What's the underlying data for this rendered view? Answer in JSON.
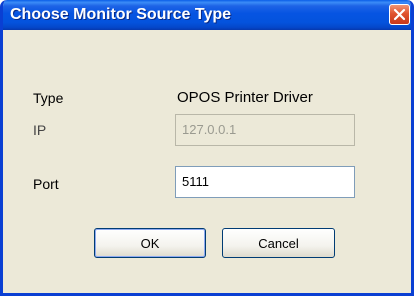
{
  "dialog": {
    "title": "Choose Monitor Source Type",
    "close_icon": "close-icon"
  },
  "fields": {
    "type_label": "Type",
    "type_value": "OPOS Printer Driver",
    "ip_label": "IP",
    "ip_value": "127.0.0.1",
    "port_label": "Port",
    "port_value": "5111"
  },
  "buttons": {
    "ok_label": "OK",
    "cancel_label": "Cancel"
  },
  "colors": {
    "titlebar": "#0654e2",
    "dialog_bg": "#ece9d8",
    "close_button": "#e0532e"
  }
}
